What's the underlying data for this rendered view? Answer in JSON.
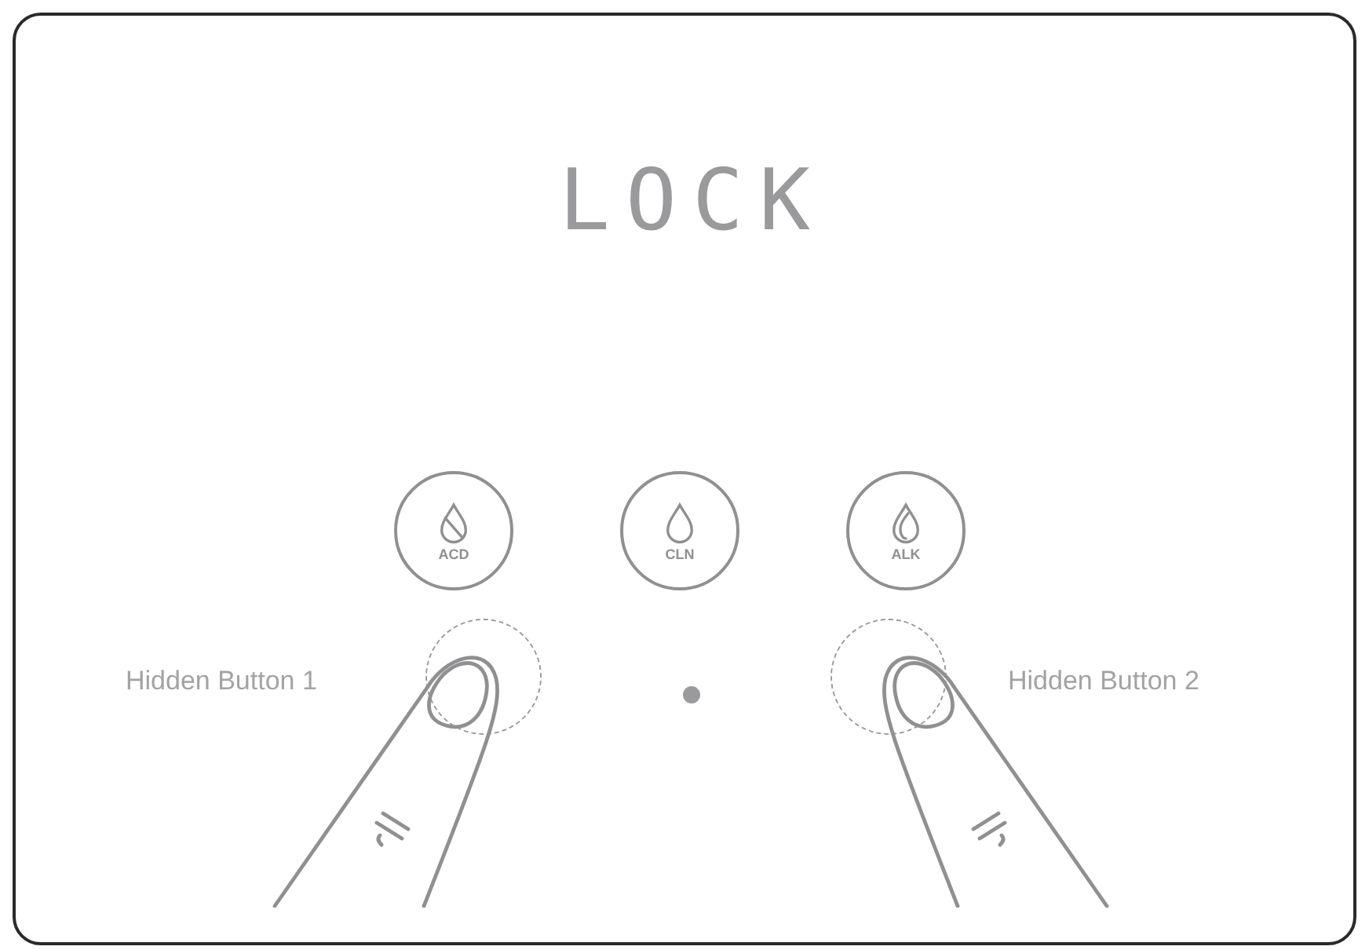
{
  "display": {
    "text": "LOCK"
  },
  "mode_buttons": [
    {
      "label": "ACD",
      "kind": "acid"
    },
    {
      "label": "CLN",
      "kind": "clean"
    },
    {
      "label": "ALK",
      "kind": "alkaline"
    }
  ],
  "indicator": {
    "on": true
  },
  "hidden_buttons": [
    {
      "label": "Hidden Button 1",
      "kind": "left"
    },
    {
      "label": "Hidden Button 2",
      "kind": "right"
    }
  ]
}
